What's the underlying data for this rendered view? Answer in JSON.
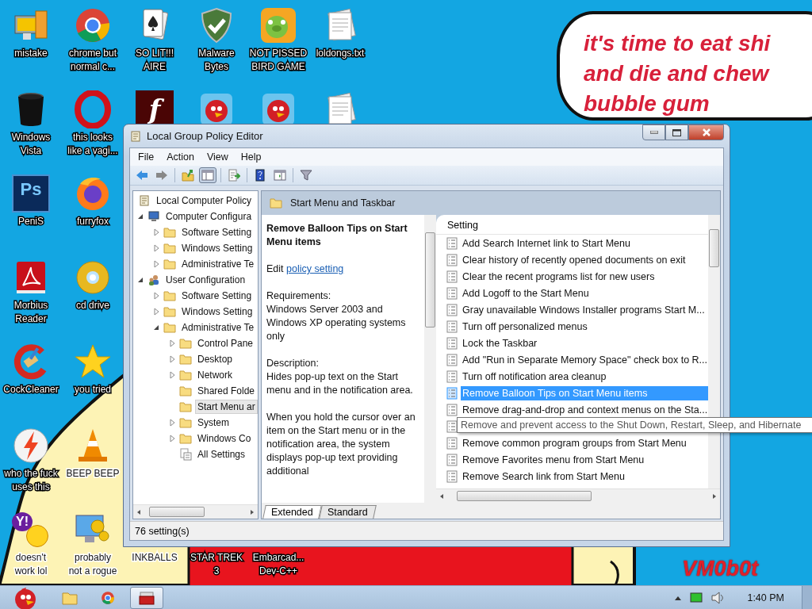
{
  "desktop": {
    "rows": [
      [
        {
          "kind": "computer",
          "label": "mistake"
        },
        {
          "kind": "chrome",
          "label": "chrome but\nnormal c..."
        },
        {
          "kind": "cards",
          "label": "SO LIT!!!\nAIRE"
        },
        {
          "kind": "shield",
          "label": "Malware\nBytes"
        },
        {
          "kind": "pig",
          "label": "NOT PISSED\nBIRD GAME"
        },
        {
          "kind": "document",
          "label": "loldongs.txt"
        }
      ],
      [
        {
          "kind": "trash",
          "label": "Windows\nVista"
        },
        {
          "kind": "opera",
          "label": "this looks\nlike a vagi..."
        },
        {
          "kind": "flash",
          "glyph": "f"
        },
        {
          "kind": "bird"
        },
        {
          "kind": "bird"
        },
        {
          "kind": "document"
        }
      ],
      [
        {
          "kind": "photoshop",
          "glyph": "Ps",
          "label": "PeniS"
        },
        {
          "kind": "firefox",
          "label": "furryfox"
        }
      ],
      [
        {
          "kind": "pdf",
          "label": "Morbius\nReader"
        },
        {
          "kind": "cd",
          "label": "cd drive"
        }
      ],
      [
        {
          "kind": "cleaner",
          "label": "CockCleaner"
        },
        {
          "kind": "star",
          "label": "you tried"
        }
      ],
      [
        {
          "kind": "bolt",
          "label": "who the fuck\nuses this"
        },
        {
          "kind": "cone",
          "label": "BEEP BEEP"
        }
      ],
      [
        {
          "kind": "yahoo",
          "glyph": "Y!",
          "label": "doesn't\nwork lol"
        },
        {
          "kind": "gears",
          "label": "probably\nnot a rogue"
        },
        {
          "label": "INKBALLS"
        },
        {
          "label": "STAR TREK\n3"
        },
        {
          "label": "Embarcad...\nDev-C++"
        }
      ]
    ]
  },
  "speech_bubble": {
    "text": "it's time to eat shi\nand die and chew\nbubble gum"
  },
  "signature": "VM0b0t",
  "window": {
    "title": "Local Group Policy Editor",
    "menu": [
      "File",
      "Action",
      "View",
      "Help"
    ],
    "toolbar": [
      {
        "kind": "back",
        "pressed": false
      },
      {
        "kind": "forward",
        "pressed": false
      },
      {
        "kind": "sep"
      },
      {
        "kind": "up",
        "pressed": false
      },
      {
        "kind": "tree",
        "pressed": true
      },
      {
        "kind": "sep"
      },
      {
        "kind": "export",
        "pressed": false
      },
      {
        "kind": "sep"
      },
      {
        "kind": "help",
        "pressed": false
      },
      {
        "kind": "pane",
        "pressed": false
      },
      {
        "kind": "sep"
      },
      {
        "kind": "filter",
        "pressed": false
      }
    ],
    "tree": {
      "label": "Local Computer Policy",
      "kind": "policy",
      "selected": false,
      "children": [
        {
          "label": "Computer Configura",
          "kind": "computer",
          "expanded": true,
          "selected": false,
          "children": [
            {
              "label": "Software Setting",
              "kind": "folder",
              "expanded": false,
              "selected": false
            },
            {
              "label": "Windows Setting",
              "kind": "folder",
              "expanded": false,
              "selected": false
            },
            {
              "label": "Administrative Te",
              "kind": "folder",
              "expanded": false,
              "selected": false
            }
          ]
        },
        {
          "label": "User Configuration",
          "kind": "users",
          "expanded": true,
          "selected": false,
          "children": [
            {
              "label": "Software Setting",
              "kind": "folder",
              "expanded": false,
              "selected": false
            },
            {
              "label": "Windows Setting",
              "kind": "folder",
              "expanded": false,
              "selected": false
            },
            {
              "label": "Administrative Te",
              "kind": "folder",
              "expanded": true,
              "selected": false,
              "children": [
                {
                  "label": "Control Pane",
                  "kind": "folder",
                  "expanded": false,
                  "selected": false
                },
                {
                  "label": "Desktop",
                  "kind": "folder",
                  "expanded": false,
                  "selected": false
                },
                {
                  "label": "Network",
                  "kind": "folder",
                  "expanded": false,
                  "selected": false
                },
                {
                  "label": "Shared Folde",
                  "kind": "folder",
                  "selected": false
                },
                {
                  "label": "Start Menu ar",
                  "kind": "folder",
                  "selected": true
                },
                {
                  "label": "System",
                  "kind": "folder",
                  "expanded": false,
                  "selected": false
                },
                {
                  "label": "Windows Co",
                  "kind": "folder",
                  "expanded": false,
                  "selected": false
                },
                {
                  "label": "All Settings",
                  "kind": "settings",
                  "selected": false
                }
              ]
            }
          ]
        }
      ]
    },
    "header": "Start Menu and Taskbar",
    "description": {
      "title": "Remove Balloon Tips on Start Menu items",
      "edit_prefix": "Edit",
      "edit_link": "policy setting",
      "requirements_label": "Requirements:",
      "requirements": "Windows Server 2003 and Windows XP operating systems only",
      "description_label": "Description:",
      "description": "Hides pop-up text on the Start menu and in the notification area.",
      "details": "When you hold the cursor over an item on the Start menu or in the notification area, the system displays pop-up text providing additional"
    },
    "settings": {
      "column": "Setting",
      "rows": [
        {
          "label": "Add Search Internet link to Start Menu",
          "selected": false
        },
        {
          "label": "Clear history of recently opened documents on exit",
          "selected": false
        },
        {
          "label": "Clear the recent programs list for new users",
          "selected": false
        },
        {
          "label": "Add Logoff to the Start Menu",
          "selected": false
        },
        {
          "label": "Gray unavailable Windows Installer programs Start M...",
          "selected": false
        },
        {
          "label": "Turn off personalized menus",
          "selected": false
        },
        {
          "label": "Lock the Taskbar",
          "selected": false
        },
        {
          "label": "Add \"Run in Separate Memory Space\" check box to R...",
          "selected": false
        },
        {
          "label": "Turn off notification area cleanup",
          "selected": false
        },
        {
          "label": "Remove Balloon Tips on Start Menu items",
          "selected": true
        },
        {
          "label": "Remove drag-and-drop and context menus on the Sta...",
          "selected": false
        },
        {
          "selected": false
        },
        {
          "label": "Remove common program groups from Start Menu",
          "selected": false
        },
        {
          "label": "Remove Favorites menu from Start Menu",
          "selected": false
        },
        {
          "label": "Remove Search link from Start Menu",
          "selected": false
        }
      ],
      "tooltip": "Remove and prevent access to the Shut Down, Restart, Sleep, and Hibernate"
    },
    "tabs": [
      {
        "label": "Extended",
        "selected": true
      },
      {
        "label": "Standard",
        "selected": false
      }
    ],
    "status_bar": "76 setting(s)"
  },
  "taskbar": {
    "buttons": [
      {
        "kind": "start",
        "active": false
      },
      {
        "kind": "folder",
        "active": false
      },
      {
        "kind": "chrome",
        "active": false
      },
      {
        "kind": "policy",
        "active": true
      }
    ],
    "clock": "1:40 PM"
  }
}
